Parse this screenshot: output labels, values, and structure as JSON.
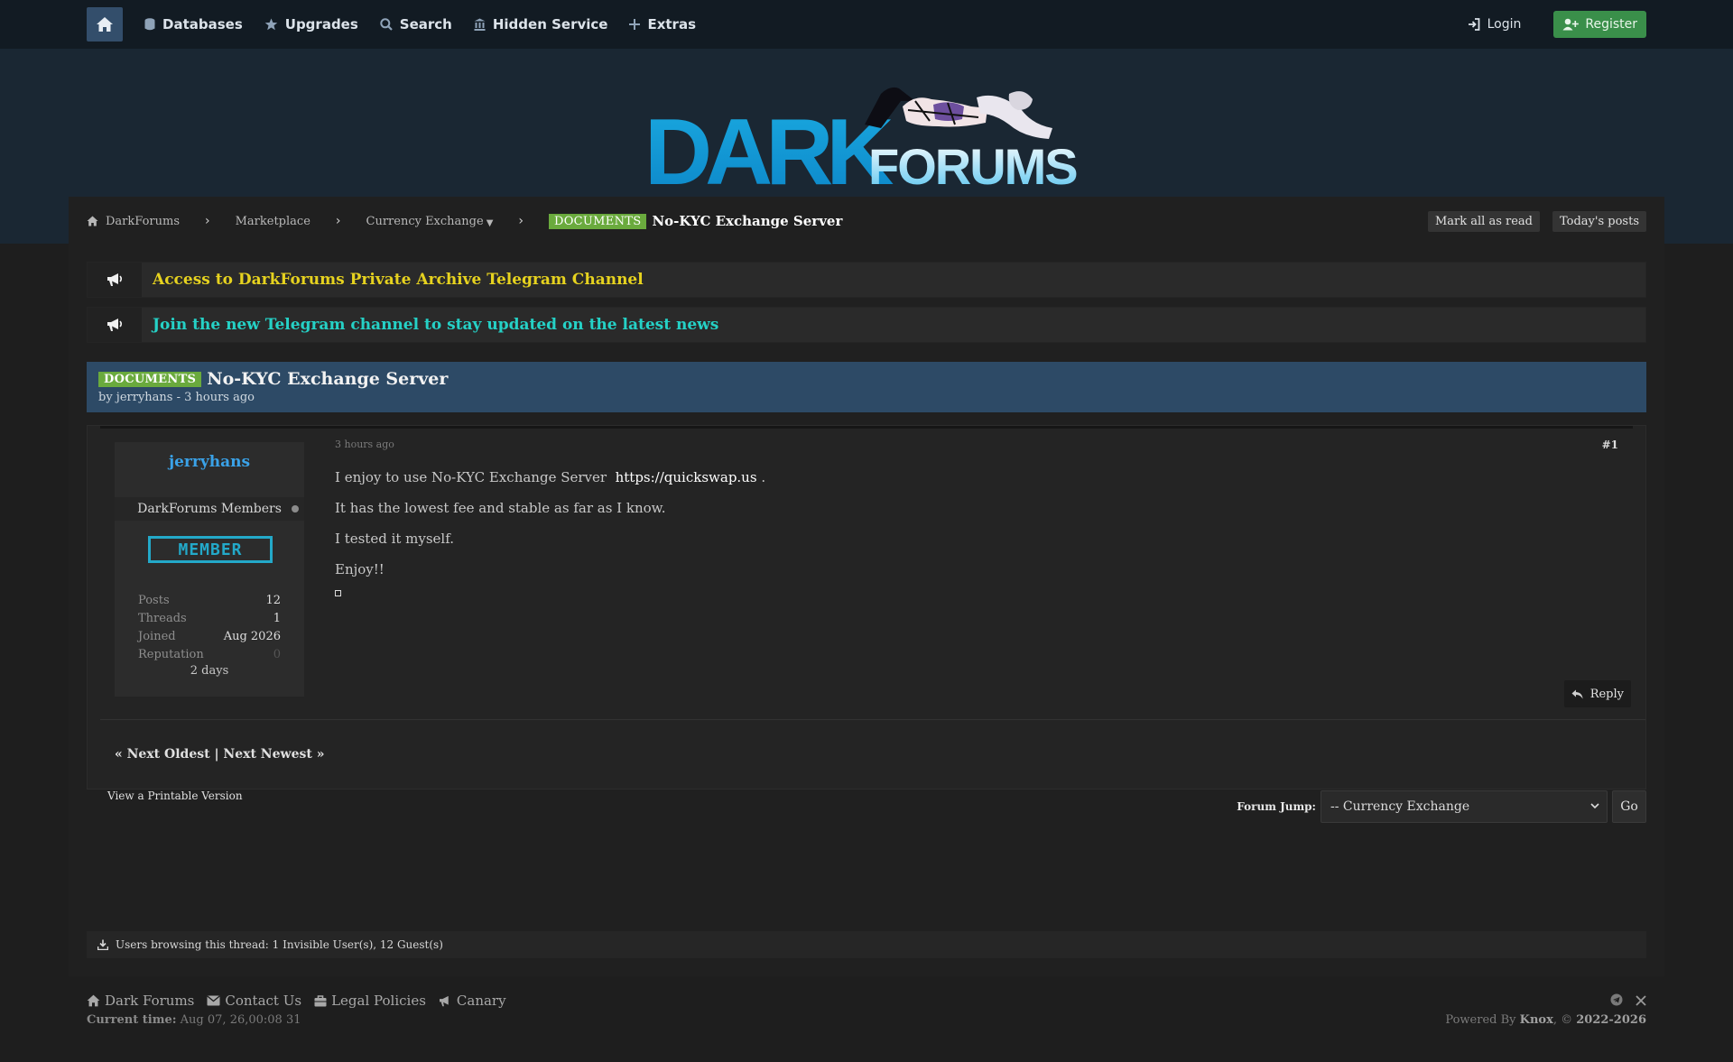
{
  "nav": {
    "items": [
      {
        "label": "Databases",
        "icon": "database-icon"
      },
      {
        "label": "Upgrades",
        "icon": "star-icon"
      },
      {
        "label": "Search",
        "icon": "search-icon"
      },
      {
        "label": "Hidden Service",
        "icon": "building-icon"
      },
      {
        "label": "Extras",
        "icon": "plus-icon"
      }
    ],
    "login": "Login",
    "register": "Register"
  },
  "logo": {
    "part1": "DARK",
    "part2": "FORUMS"
  },
  "breadcrumb": {
    "items": [
      "DarkForums",
      "Marketplace",
      "Currency Exchange"
    ],
    "prefix": "DOCUMENTS",
    "title": "No-KYC Exchange Server",
    "mark_read": "Mark all as read",
    "todays_posts": "Today's posts"
  },
  "announcements": [
    {
      "text": "Access to DarkForums Private Archive Telegram Channel",
      "color": "#e6d21f"
    },
    {
      "text": "Join the new Telegram channel to stay updated on the latest news",
      "color": "#25d1c6"
    }
  ],
  "thread": {
    "prefix": "DOCUMENTS",
    "title": "No-KYC Exchange Server",
    "byline": "by jerryhans - 3 hours ago"
  },
  "post": {
    "author": "jerryhans",
    "group": "DarkForums Members",
    "badge": "MEMBER",
    "stats": [
      {
        "key": "Posts",
        "value": "12"
      },
      {
        "key": "Threads",
        "value": "1"
      },
      {
        "key": "Joined",
        "value": "Aug 2026"
      },
      {
        "key": "Reputation",
        "value": "0"
      }
    ],
    "online": "2 days",
    "date": "3 hours ago",
    "number": "#1",
    "line1_text": "I enjoy to use No-KYC Exchange Server",
    "line1_link": "https://quickswap.us",
    "line1_end": ".",
    "line2": "It has the lowest fee and stable as far as I know.",
    "line3": "I tested it myself.",
    "line4": "Enjoy!!",
    "reply": "Reply"
  },
  "pagination": "« Next Oldest | Next Newest »",
  "printable": "View a Printable Version",
  "forum_jump": {
    "label": "Forum Jump:",
    "selected": "-- Currency Exchange",
    "go": "Go"
  },
  "browsing": "Users browsing this thread: 1 Invisible User(s), 12 Guest(s)",
  "footer": {
    "links": [
      "Dark Forums",
      "Contact Us",
      "Legal Policies",
      "Canary"
    ],
    "time_label": "Current time:",
    "time_value": "Aug 07, 26,00:08 31",
    "powered_prefix": "Powered By",
    "powered_name": "Knox",
    "powered_sep": ", ©",
    "powered_years": "2022-2026"
  }
}
